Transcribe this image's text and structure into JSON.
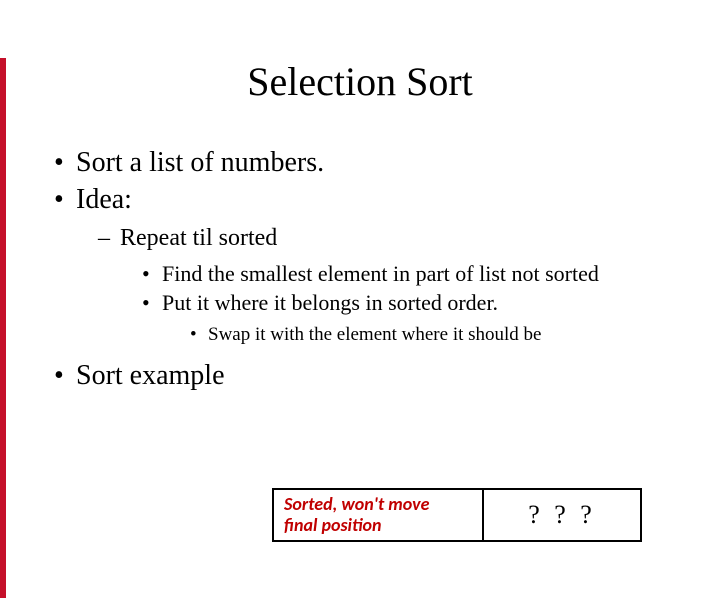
{
  "title": "Selection Sort",
  "bullets": {
    "b1": "Sort a list of numbers.",
    "b2": "Idea:",
    "b2_1": "Repeat til sorted",
    "b2_1_1": "Find the smallest element in part of list not sorted",
    "b2_1_2": "Put it where it belongs in sorted order.",
    "b2_1_2_1": "Swap it with the element where it should be",
    "b3": "Sort example"
  },
  "diagram": {
    "left_line1": "Sorted, won't move",
    "left_line2": "final position",
    "right": "? ? ?"
  }
}
